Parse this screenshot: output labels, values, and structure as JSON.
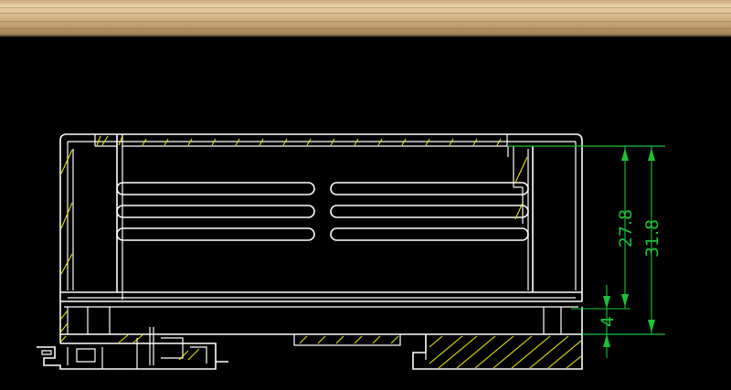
{
  "dimensions": [
    {
      "id": "inner-height",
      "label": "27.8"
    },
    {
      "id": "outer-height",
      "label": "31.8"
    },
    {
      "id": "base-offset",
      "label": "4"
    }
  ],
  "colors": {
    "background": "#000000",
    "outline": "#ffffff",
    "hatch": "#e6e600",
    "dimension": "#19c23a",
    "wood": "#d8bb8c"
  }
}
